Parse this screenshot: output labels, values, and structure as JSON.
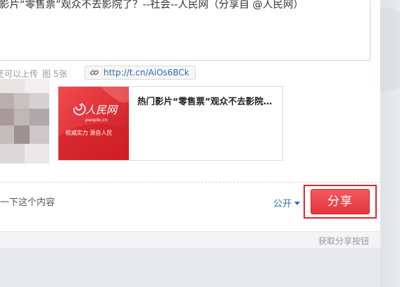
{
  "post": {
    "text": "影片“零售票”观众不去影院了？--社会--人民网（分享自 @人民网）"
  },
  "meta": {
    "left_text": "还可以上传",
    "middle_text": "图 5张"
  },
  "link": {
    "url": "http://t.cn/AiOs6BCk",
    "icon": "link-icon"
  },
  "card": {
    "title": "热门影片“零售票”观众不去影院…",
    "logo_cn": "人民网",
    "logo_en": "people.cn",
    "slogan": "权威实力 源自人民",
    "brand_color": "#e2262d"
  },
  "hint": {
    "text": "一下这个内容"
  },
  "visibility": {
    "label": "公开",
    "icon": "caret-down-icon"
  },
  "share_button": {
    "label": "分享",
    "color": "#e5343b",
    "highlight_color": "#e0262c"
  },
  "footer": {
    "link": "获取分享按钮"
  }
}
